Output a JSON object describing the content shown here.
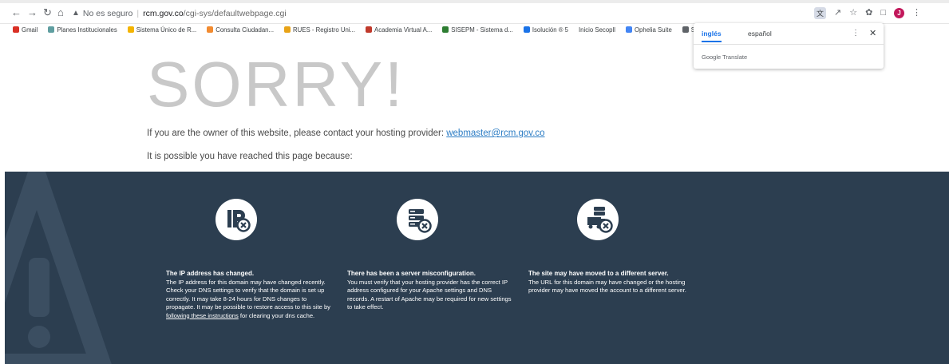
{
  "browser": {
    "omnibox": {
      "security_text": "No es seguro",
      "url_host": "rcm.gov.co",
      "url_path": "/cgi-sys/defaultwebpage.cgi"
    },
    "bookmarks": [
      {
        "label": "Gmail",
        "icon": "gmail-icon",
        "color": "#d93025"
      },
      {
        "label": "Planes Institucionales",
        "icon": "planes-icon",
        "color": "#5f9ea0"
      },
      {
        "label": "Sistema Único de R...",
        "icon": "folder-icon",
        "color": "#f4b400"
      },
      {
        "label": "Consulta Ciudadan...",
        "icon": "consulta-icon",
        "color": "#f28b30"
      },
      {
        "label": "RUES - Registro Uni...",
        "icon": "rues-icon",
        "color": "#e8a317"
      },
      {
        "label": "Academia Virtual A...",
        "icon": "academia-icon",
        "color": "#c0392b"
      },
      {
        "label": "SISEPM - Sistema d...",
        "icon": "sisepm-icon",
        "color": "#2e7d32"
      },
      {
        "label": "Isolución ® 5",
        "icon": "isolucion-icon",
        "color": "#1a73e8"
      },
      {
        "label": "Inicio Secopll",
        "icon": "",
        "color": ""
      },
      {
        "label": "Ophelia Suite",
        "icon": "ophelia-icon",
        "color": "#4285f4"
      },
      {
        "label": "Sistema",
        "icon": "globe-icon",
        "color": "#5f6368"
      }
    ],
    "translate_popup": {
      "tab_source": "inglés",
      "tab_target": "español",
      "footer": "Google Translate"
    }
  },
  "page": {
    "headline": "SORRY!",
    "owner_prefix": "If you are the owner of this website, please contact your hosting provider: ",
    "owner_email": "webmaster@rcm.gov.co",
    "reason_intro": "It is possible you have reached this page because:",
    "reasons": [
      {
        "icon": "ip-error-icon",
        "title": "The IP address has changed.",
        "body": "The IP address for this domain may have changed recently. Check your DNS settings to verify that the domain is set up correctly. It may take 8-24 hours for DNS changes to propagate. It may be possible to restore access to this site by ",
        "link": "following these instructions",
        "body_after": " for clearing your dns cache."
      },
      {
        "icon": "server-error-icon",
        "title": "There has been a server misconfiguration.",
        "body": "You must verify that your hosting provider has the correct IP address configured for your Apache settings and DNS records. A restart of Apache may be required for new settings to take effect."
      },
      {
        "icon": "server-moved-icon",
        "title": "The site may have moved to a different server.",
        "body": "The URL for this domain may have changed or the hosting provider may have moved the account to a different server."
      }
    ]
  },
  "colors": {
    "band": "#2c3e50",
    "headline": "#c8c8c8",
    "link": "#2b7cc4"
  }
}
